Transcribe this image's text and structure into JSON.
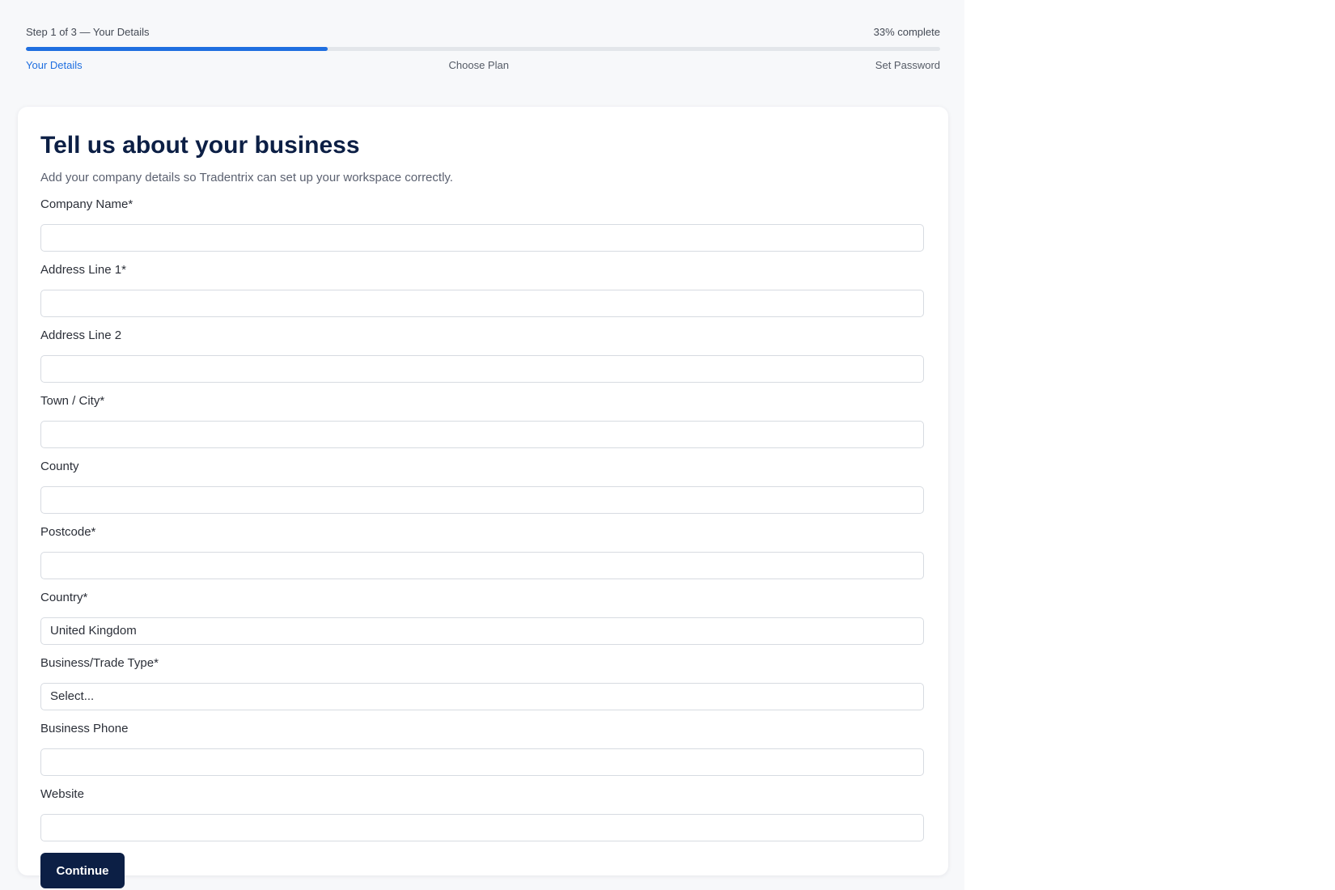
{
  "stepper": {
    "step_text": "Step 1 of 3 — Your Details",
    "complete_text": "33% complete",
    "progress_percent": 33,
    "accent_color": "#1f6fe0",
    "steps": [
      {
        "label": "Your Details",
        "active": true
      },
      {
        "label": "Choose Plan",
        "active": false
      },
      {
        "label": "Set Password",
        "active": false
      }
    ]
  },
  "form": {
    "title": "Tell us about your business",
    "subtitle": "Add your company details so Tradentrix can set up your workspace correctly.",
    "fields": {
      "company_name": {
        "label": "Company Name*",
        "value": ""
      },
      "address_line_1": {
        "label": "Address Line 1*",
        "value": ""
      },
      "address_line_2": {
        "label": "Address Line 2",
        "value": ""
      },
      "town_city": {
        "label": "Town / City*",
        "value": ""
      },
      "county": {
        "label": "County",
        "value": ""
      },
      "postcode": {
        "label": "Postcode*",
        "value": ""
      },
      "country": {
        "label": "Country*",
        "value": "United Kingdom"
      },
      "business_type": {
        "label": "Business/Trade Type*",
        "value": "Select..."
      },
      "business_phone": {
        "label": "Business Phone",
        "value": ""
      },
      "website": {
        "label": "Website",
        "value": ""
      }
    },
    "continue_label": "Continue",
    "button_color": "#0c1f45"
  }
}
